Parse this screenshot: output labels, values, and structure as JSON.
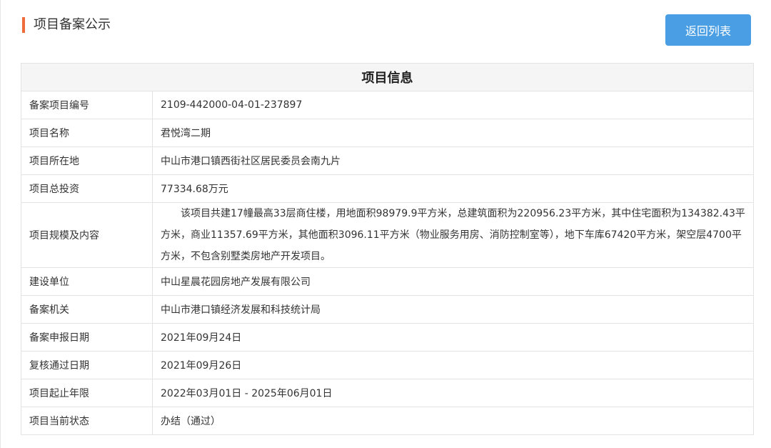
{
  "header": {
    "title": "项目备案公示",
    "back_button_label": "返回列表"
  },
  "table": {
    "heading": "项目信息",
    "rows": [
      {
        "label": "备案项目编号",
        "value": "2109-442000-04-01-237897"
      },
      {
        "label": "项目名称",
        "value": "君悦湾二期"
      },
      {
        "label": "项目所在地",
        "value": "中山市港口镇西街社区居民委员会南九片"
      },
      {
        "label": "项目总投资",
        "value": "77334.68万元"
      },
      {
        "label": "项目规模及内容",
        "value": "该项目共建17幢最高33层商住楼，用地面积98979.9平方米，总建筑面积为220956.23平方米，其中住宅面积为134382.43平方米，商业11357.69平方米，其他面积3096.11平方米（物业服务用房、消防控制室等），地下车库67420平方米，架空层4700平方米，不包含别墅类房地产开发项目。"
      },
      {
        "label": "建设单位",
        "value": "中山星晨花园房地产发展有限公司"
      },
      {
        "label": "备案机关",
        "value": "中山市港口镇经济发展和科技统计局"
      },
      {
        "label": "备案申报日期",
        "value": "2021年09月24日"
      },
      {
        "label": "复核通过日期",
        "value": "2021年09月26日"
      },
      {
        "label": "项目起止年限",
        "value": "2022年03月01日 - 2025年06月01日"
      },
      {
        "label": "项目当前状态",
        "value": "办结（通过）"
      }
    ]
  },
  "colors": {
    "accent_bar": "#f06b3a",
    "button_bg": "#4a9ee3",
    "header_bg": "#f5f5f5",
    "border": "#e3e3e3"
  }
}
